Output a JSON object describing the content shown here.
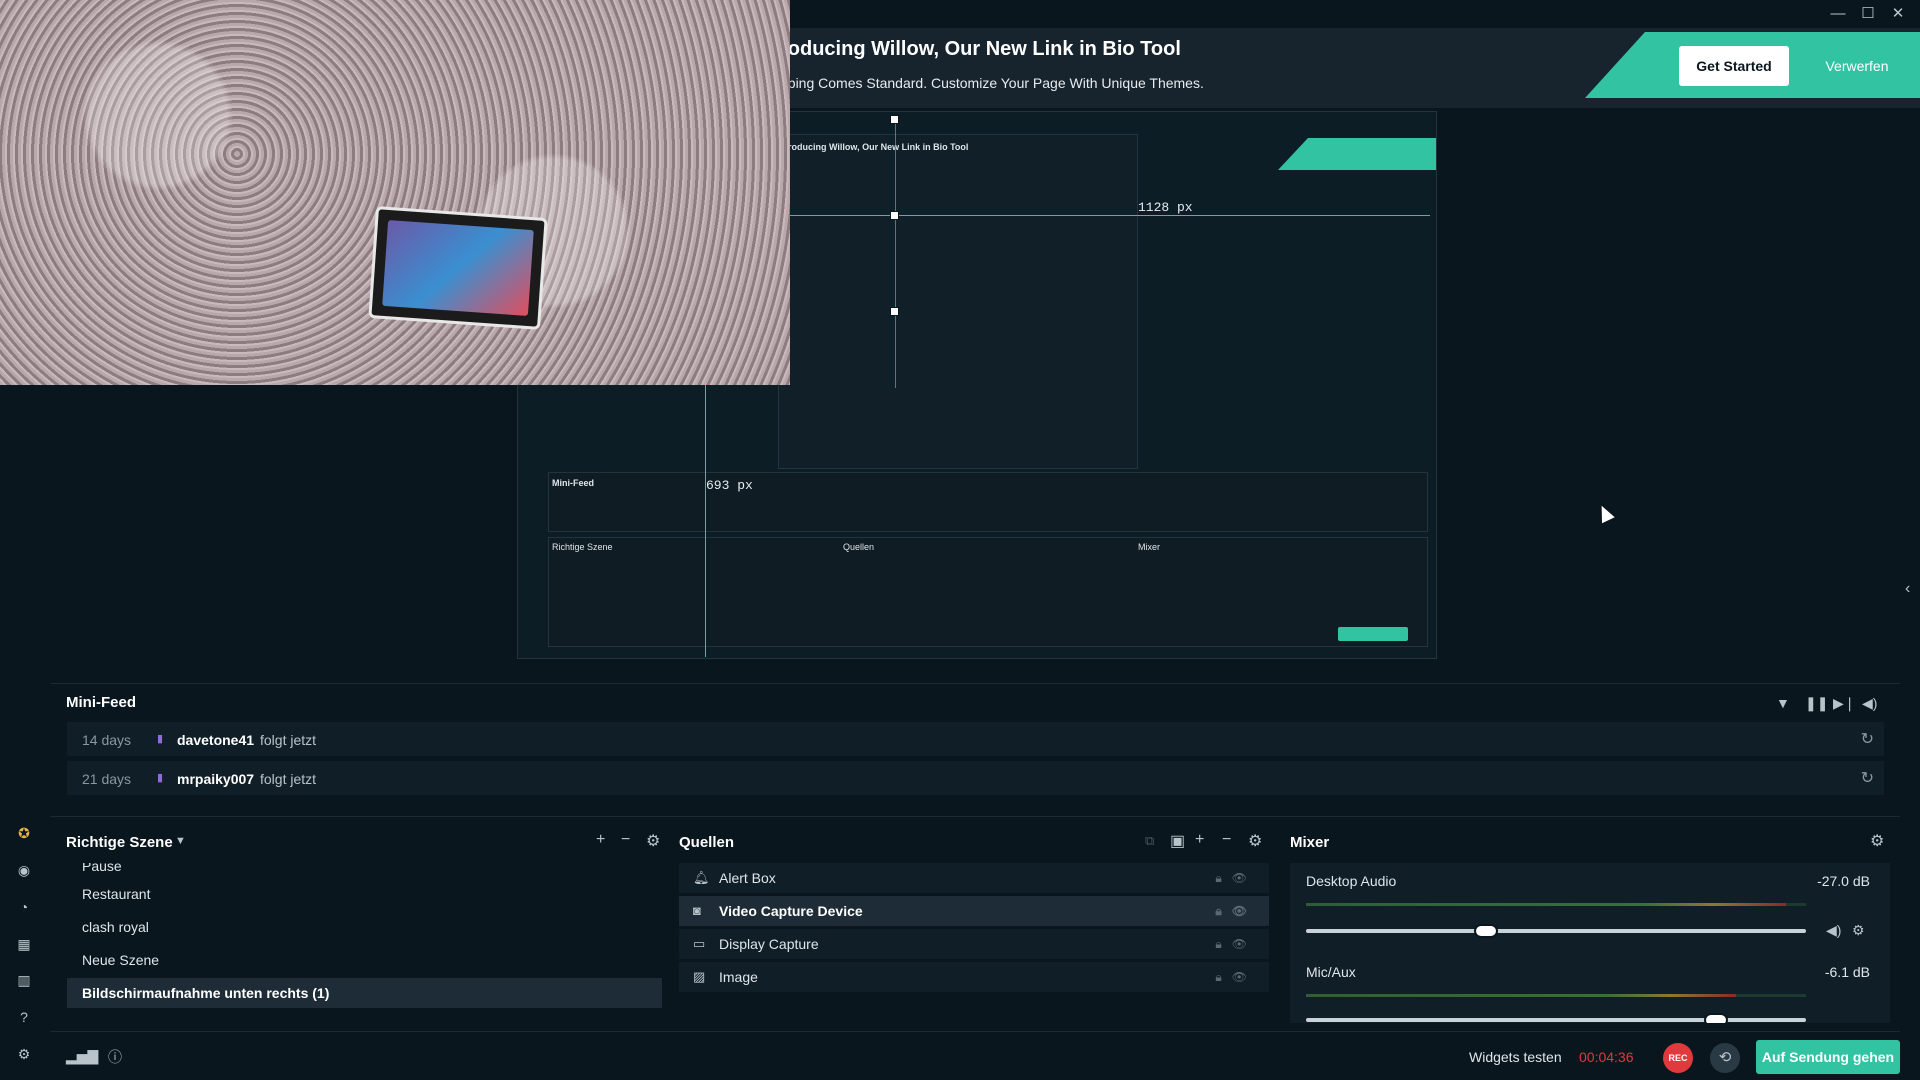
{
  "banner": {
    "title": "roducing Willow, Our New Link in Bio Tool",
    "subtitle": "pping Comes Standard. Customize Your Page With Unique Themes.",
    "primary_button": "Get Started",
    "dismiss_button": "Verwerfen"
  },
  "editor": {
    "guide_horizontal_label": "1128 px",
    "guide_vertical_label": "693 px"
  },
  "mini_feed": {
    "title": "Mini-Feed",
    "events": [
      {
        "time": "14 days",
        "user": "davetone41",
        "action": "folgt jetzt"
      },
      {
        "time": "21 days",
        "user": "mrpaiky007",
        "action": "folgt jetzt"
      }
    ]
  },
  "scenes": {
    "title": "Richtige Szene",
    "items": [
      {
        "label": "Pause"
      },
      {
        "label": "Restaurant"
      },
      {
        "label": "clash royal"
      },
      {
        "label": "Neue Szene"
      },
      {
        "label": "Bildschirmaufnahme unten rechts (1)"
      }
    ],
    "selected_index": 4
  },
  "sources": {
    "title": "Quellen",
    "items": [
      {
        "label": "Alert Box",
        "icon": "bell-icon"
      },
      {
        "label": "Video Capture Device",
        "icon": "webcam-icon"
      },
      {
        "label": "Display Capture",
        "icon": "monitor-icon"
      },
      {
        "label": "Image",
        "icon": "image-icon"
      }
    ],
    "selected_index": 1
  },
  "mixer": {
    "title": "Mixer",
    "channels": [
      {
        "name": "Desktop Audio",
        "db": "-27.0 dB",
        "volume_fraction": 0.36
      },
      {
        "name": "Mic/Aux",
        "db": "-6.1 dB",
        "volume_fraction": 0.82
      }
    ]
  },
  "footer": {
    "test_widgets": "Widgets testen",
    "timer": "00:04:36",
    "rec_label": "REC",
    "go_live": "Auf Sendung gehen"
  },
  "colors": {
    "accent": "#31c3a2",
    "background": "#09161d",
    "rec": "#e0393e",
    "timer": "#e0393e"
  }
}
